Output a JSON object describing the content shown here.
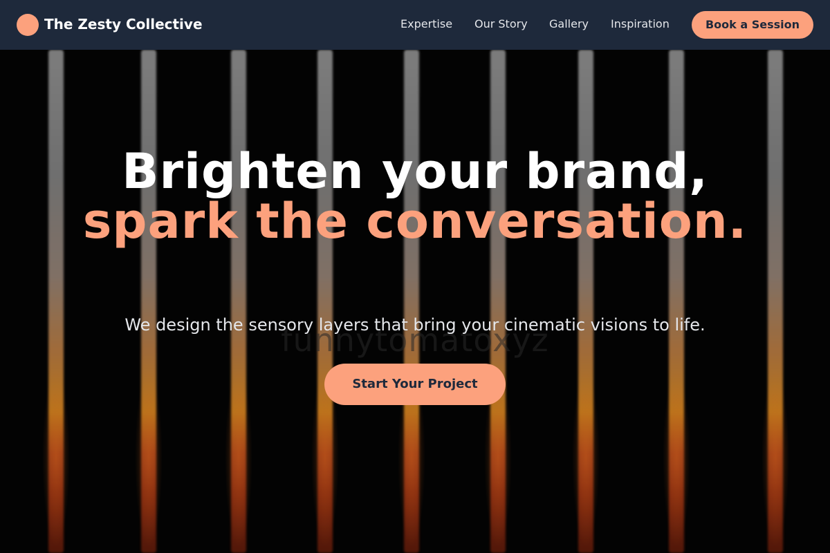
{
  "brand": {
    "name": "The Zesty Collective",
    "logo_icon": "circle-logo-icon",
    "accent_color": "#fca17d",
    "nav_background": "#1e293b"
  },
  "nav": {
    "links": [
      "Expertise",
      "Our Story",
      "Gallery",
      "Inspiration"
    ],
    "cta_label": "Book a Session"
  },
  "hero": {
    "headline_line1": "Brighten your brand,",
    "headline_line2": "spark the conversation.",
    "subheadline": "We design the sensory layers that bring your cinematic visions to life.",
    "cta_label": "Start Your Project",
    "watermark_text": "funnytomatoxyz",
    "background": "glowing-vertical-tubes"
  }
}
